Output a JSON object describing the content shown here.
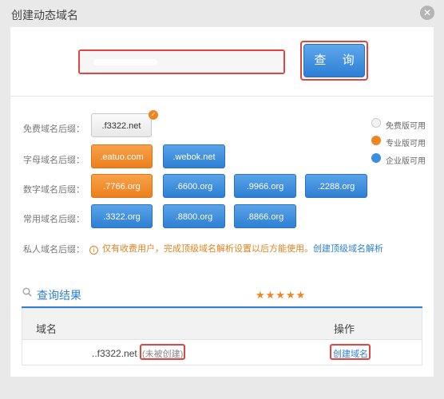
{
  "dialog": {
    "title": "创建动态域名",
    "close_icon": "close-icon"
  },
  "search": {
    "value": "",
    "query_label": "查 询"
  },
  "rows": {
    "free": {
      "label": "免费域名后缀：",
      "options": [
        ".f3322.net"
      ]
    },
    "letters": {
      "label": "字母域名后缀：",
      "options": [
        ".eatuo.com",
        ".webok.net"
      ]
    },
    "numbers": {
      "label": "数字域名后缀：",
      "options": [
        ".7766.org",
        ".6600.org",
        ".9966.org",
        ".2288.org"
      ]
    },
    "common": {
      "label": "常用域名后缀：",
      "options": [
        ".3322.org",
        ".8800.org",
        ".8866.org"
      ]
    },
    "private": {
      "label": "私人域名后缀：",
      "notice": "仅有收费用户，完成顶级域名解析设置以后方能使用。",
      "link": "创建顶级域名解析"
    }
  },
  "legend": [
    {
      "label": "免费版可用",
      "color": "#f2f2f2"
    },
    {
      "label": "专业版可用",
      "color": "#ef8422"
    },
    {
      "label": "企业版可用",
      "color": "#3b8de0"
    }
  ],
  "results": {
    "title": "查询结果",
    "rating": "★★★★★",
    "columns": [
      "域名",
      "操作"
    ],
    "rows": [
      {
        "domain": "..f3322.net",
        "status": "(未被创建)",
        "action": "创建域名"
      }
    ]
  },
  "colors": {
    "accent_blue": "#2e80d4",
    "accent_orange": "#ef8422",
    "highlight_red": "#e0463f"
  }
}
